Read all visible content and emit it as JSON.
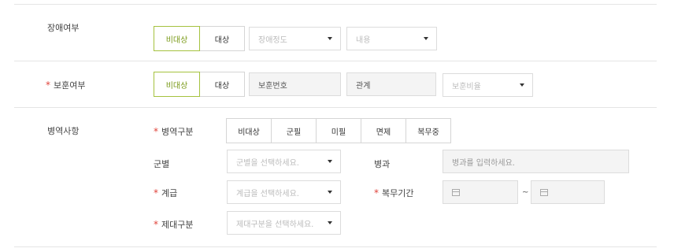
{
  "disability": {
    "label": "장애여부",
    "options": [
      "비대상",
      "대상"
    ],
    "selected": "비대상",
    "degree_placeholder": "장애정도",
    "content_placeholder": "내용"
  },
  "veteran": {
    "required_mark": "*",
    "label": "보훈여부",
    "options": [
      "비대상",
      "대상"
    ],
    "selected": "비대상",
    "number_placeholder": "보훈번호",
    "relation_placeholder": "관계",
    "ratio_placeholder": "보훈비율"
  },
  "military": {
    "label": "병역사항",
    "status": {
      "required_mark": "*",
      "label": "병역구분",
      "options": [
        "비대상",
        "군필",
        "미필",
        "면제",
        "복무중"
      ]
    },
    "branch": {
      "label": "군별",
      "placeholder": "군별을 선택하세요."
    },
    "specialty": {
      "label": "병과",
      "placeholder": "병과를 입력하세요."
    },
    "rank": {
      "required_mark": "*",
      "label": "계급",
      "placeholder": "계급을 선택하세요."
    },
    "period": {
      "required_mark": "*",
      "label": "복무기간",
      "separator": "~"
    },
    "discharge": {
      "required_mark": "*",
      "label": "제대구분",
      "placeholder": "제대구분을 선택하세요."
    }
  },
  "colors": {
    "accent": "#a5c23f",
    "required": "#e0443b",
    "border": "#dcdcdc",
    "fill": "#f4f4f4"
  }
}
